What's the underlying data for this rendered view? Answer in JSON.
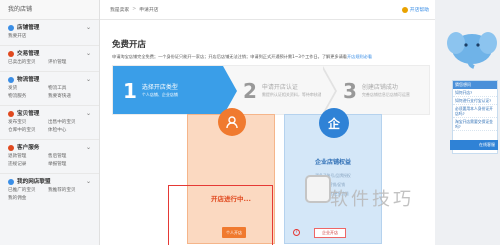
{
  "sidebar": {
    "title": "我的店铺",
    "sections": [
      {
        "label": "店铺管理",
        "color": "#3a8ee6",
        "items": [
          "我要开店"
        ]
      },
      {
        "label": "交易管理",
        "color": "#e0491f",
        "items": [
          "已卖出的宝贝",
          "评价管理"
        ]
      },
      {
        "label": "物流管理",
        "color": "#3a8ee6",
        "items": [
          "发货",
          "物流工具",
          "物流服务",
          "我要寄快递"
        ]
      },
      {
        "label": "宝贝管理",
        "color": "#e0491f",
        "items": [
          "发布宝贝",
          "出售中的宝贝",
          "仓库中的宝贝",
          "体检中心"
        ]
      },
      {
        "label": "客户服务",
        "color": "#e0491f",
        "items": [
          "退款管理",
          "售后管理",
          "违规记录",
          "举报管理"
        ]
      },
      {
        "label": "我的网店联盟",
        "color": "#3a8ee6",
        "items": [
          "已推广的宝贝",
          "我推荐的宝贝",
          "我的佣金"
        ]
      }
    ]
  },
  "topbar": {
    "crumb1": "我是卖家",
    "crumb_sep": ">",
    "crumb2": "申请开店",
    "help": "开店帮助"
  },
  "main": {
    "title": "免费开店",
    "notice": "申请淘宝店铺完全免费；一个身份证只能开一家店；开店后店铺无法注销；申请到正式开通预计需1~3个工作日。了解更多请看",
    "notice_link": "开店规则必看"
  },
  "steps": [
    {
      "num": "1",
      "title": "选择开店类型",
      "sub": "个人店铺、企业店铺"
    },
    {
      "num": "2",
      "title": "申请开店认证",
      "sub": "需提供认证相关资料，等待审核通过"
    },
    {
      "num": "3",
      "title": "创建店铺成功",
      "sub": "完善店铺信息后店铺可运营"
    }
  ],
  "card_personal": {
    "status": "开店进行中...",
    "button": "个人开店"
  },
  "card_enterprise": {
    "title": "企业店铺权益",
    "features": [
      "更多子账号/品牌授权",
      "更多营销/促销",
      "更多信誉/更多流量"
    ],
    "button": "企业开店"
  },
  "right_panel": {
    "head": "猜您想问",
    "items": [
      "如何开店?",
      "如何进行支付宝认证?",
      "必须要用本人身份证开店吗?",
      "淘宝开店需要交保证金吗?"
    ],
    "cs_label": "在线客服"
  },
  "watermark": "软件技巧",
  "colors": {
    "accent": "#3a9ee8",
    "orange": "#f07a2f",
    "red": "#e53935"
  }
}
